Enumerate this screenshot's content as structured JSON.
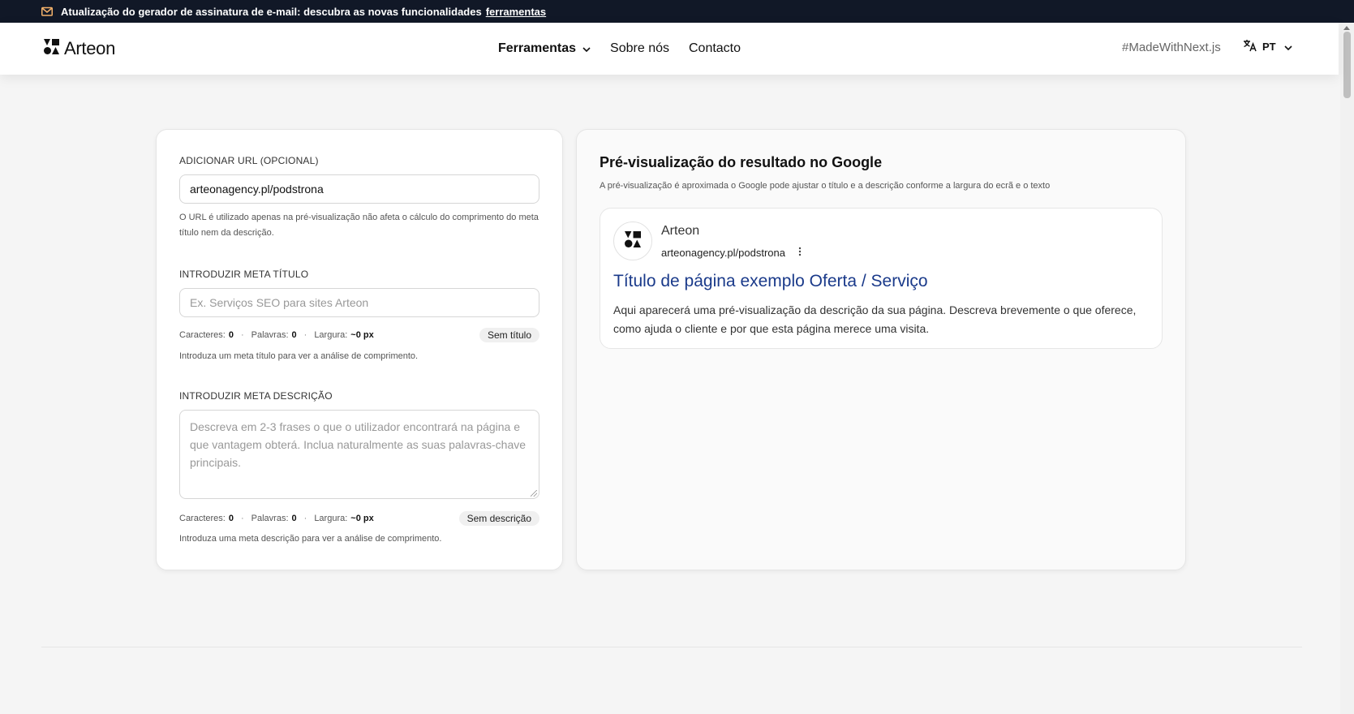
{
  "announcement": {
    "text": "Atualização do gerador de assinatura de e-mail: descubra as novas funcionalidades",
    "link": "ferramentas"
  },
  "header": {
    "logo": "Arteon",
    "nav": [
      {
        "label": "Ferramentas"
      },
      {
        "label": "Sobre nós"
      },
      {
        "label": "Contacto"
      }
    ],
    "made_with": "#MadeWithNext.js",
    "lang": "PT"
  },
  "form": {
    "url_label": "ADICIONAR URL (OPCIONAL)",
    "url_value": "arteonagency.pl/podstrona",
    "url_hint": "O URL é utilizado apenas na pré-visualização não afeta o cálculo do comprimento do meta título nem da descrição.",
    "title_label": "INTRODUZIR META TÍTULO",
    "title_placeholder": "Ex. Serviços SEO para sites  Arteon",
    "title_stats": {
      "chars_label": "Caracteres:",
      "chars": "0",
      "words_label": "Palavras:",
      "words": "0",
      "width_label": "Largura:",
      "width": "~0 px",
      "badge": "Sem título"
    },
    "title_hint": "Introduza um meta título para ver a análise de comprimento.",
    "desc_label": "INTRODUZIR META DESCRIÇÃO",
    "desc_placeholder": "Descreva em 2-3 frases o que o utilizador encontrará na página e que vantagem obterá. Inclua naturalmente as suas palavras-chave principais.",
    "desc_stats": {
      "chars_label": "Caracteres:",
      "chars": "0",
      "words_label": "Palavras:",
      "words": "0",
      "width_label": "Largura:",
      "width": "~0 px",
      "badge": "Sem descrição"
    },
    "desc_hint": "Introduza uma meta descrição para ver a análise de comprimento."
  },
  "preview": {
    "title": "Pré-visualização do resultado no Google",
    "subtitle": "A pré-visualização é aproximada o Google pode ajustar o título e a descrição conforme a largura do ecrã e o texto",
    "site_name": "Arteon",
    "url": "arteonagency.pl/podstrona",
    "result_title": "Título de página exemplo Oferta / Serviço",
    "result_desc": "Aqui aparecerá uma pré-visualização da descrição da sua página. Descreva brevemente o que oferece, como ajuda o cliente e por que esta página merece uma visita."
  },
  "colors": {
    "announcement_bg": "#111827",
    "serp_title": "#1a3a8a",
    "page_bg": "#f5f5f5"
  },
  "icons": [
    "mail-icon",
    "arteon-logo-icon",
    "chevron-down-icon",
    "translate-icon",
    "more-vertical-icon"
  ]
}
